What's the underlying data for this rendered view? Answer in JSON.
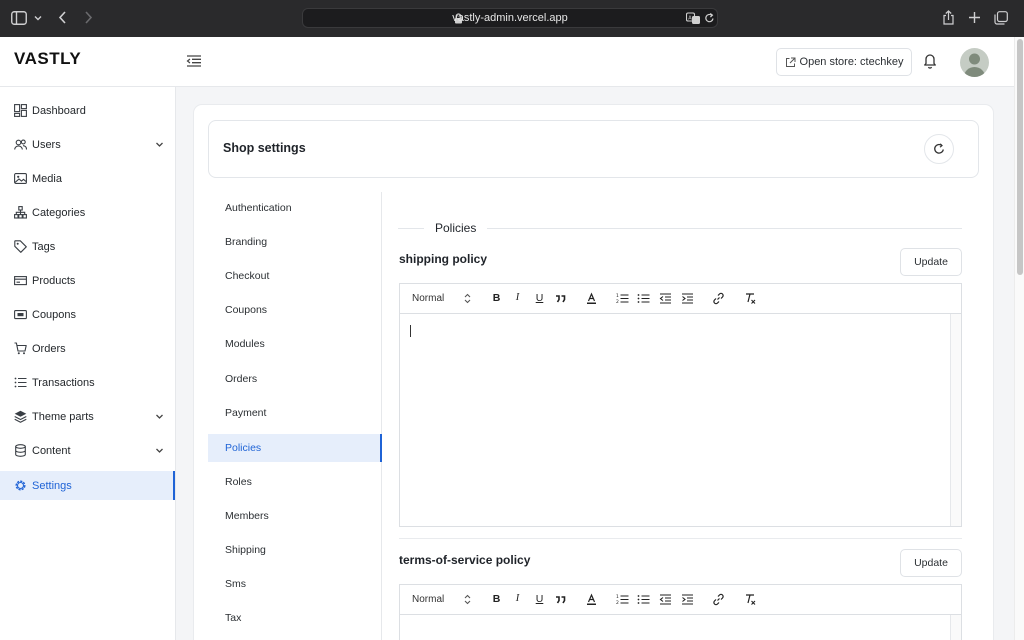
{
  "browser": {
    "url": "vastly-admin.vercel.app"
  },
  "header": {
    "logo": "VASTLY",
    "open_store_label": "Open store: ctechkey"
  },
  "sidebar": {
    "items": [
      {
        "label": "Dashboard",
        "icon": "dashboard-icon"
      },
      {
        "label": "Users",
        "icon": "users-icon",
        "expandable": true
      },
      {
        "label": "Media",
        "icon": "media-icon"
      },
      {
        "label": "Categories",
        "icon": "categories-icon"
      },
      {
        "label": "Tags",
        "icon": "tag-icon"
      },
      {
        "label": "Products",
        "icon": "products-icon"
      },
      {
        "label": "Coupons",
        "icon": "coupon-icon"
      },
      {
        "label": "Orders",
        "icon": "cart-icon"
      },
      {
        "label": "Transactions",
        "icon": "list-icon"
      },
      {
        "label": "Theme parts",
        "icon": "layers-icon",
        "expandable": true
      },
      {
        "label": "Content",
        "icon": "database-icon",
        "expandable": true
      },
      {
        "label": "Settings",
        "icon": "gear-icon",
        "active": true
      }
    ]
  },
  "settings": {
    "title": "Shop settings",
    "menu": [
      "Authentication",
      "Branding",
      "Checkout",
      "Coupons",
      "Modules",
      "Orders",
      "Payment",
      "Policies",
      "Roles",
      "Members",
      "Shipping",
      "Sms",
      "Tax"
    ],
    "active_menu": "Policies"
  },
  "policies": {
    "section_title": "Policies",
    "items": [
      {
        "title": "shipping policy",
        "update_label": "Update",
        "format": "Normal"
      },
      {
        "title": "terms-of-service policy",
        "update_label": "Update",
        "format": "Normal"
      }
    ]
  },
  "colors": {
    "accent": "#1f63d6",
    "active_bg": "#e6eefb",
    "browser_chrome": "#2a2a2c"
  }
}
